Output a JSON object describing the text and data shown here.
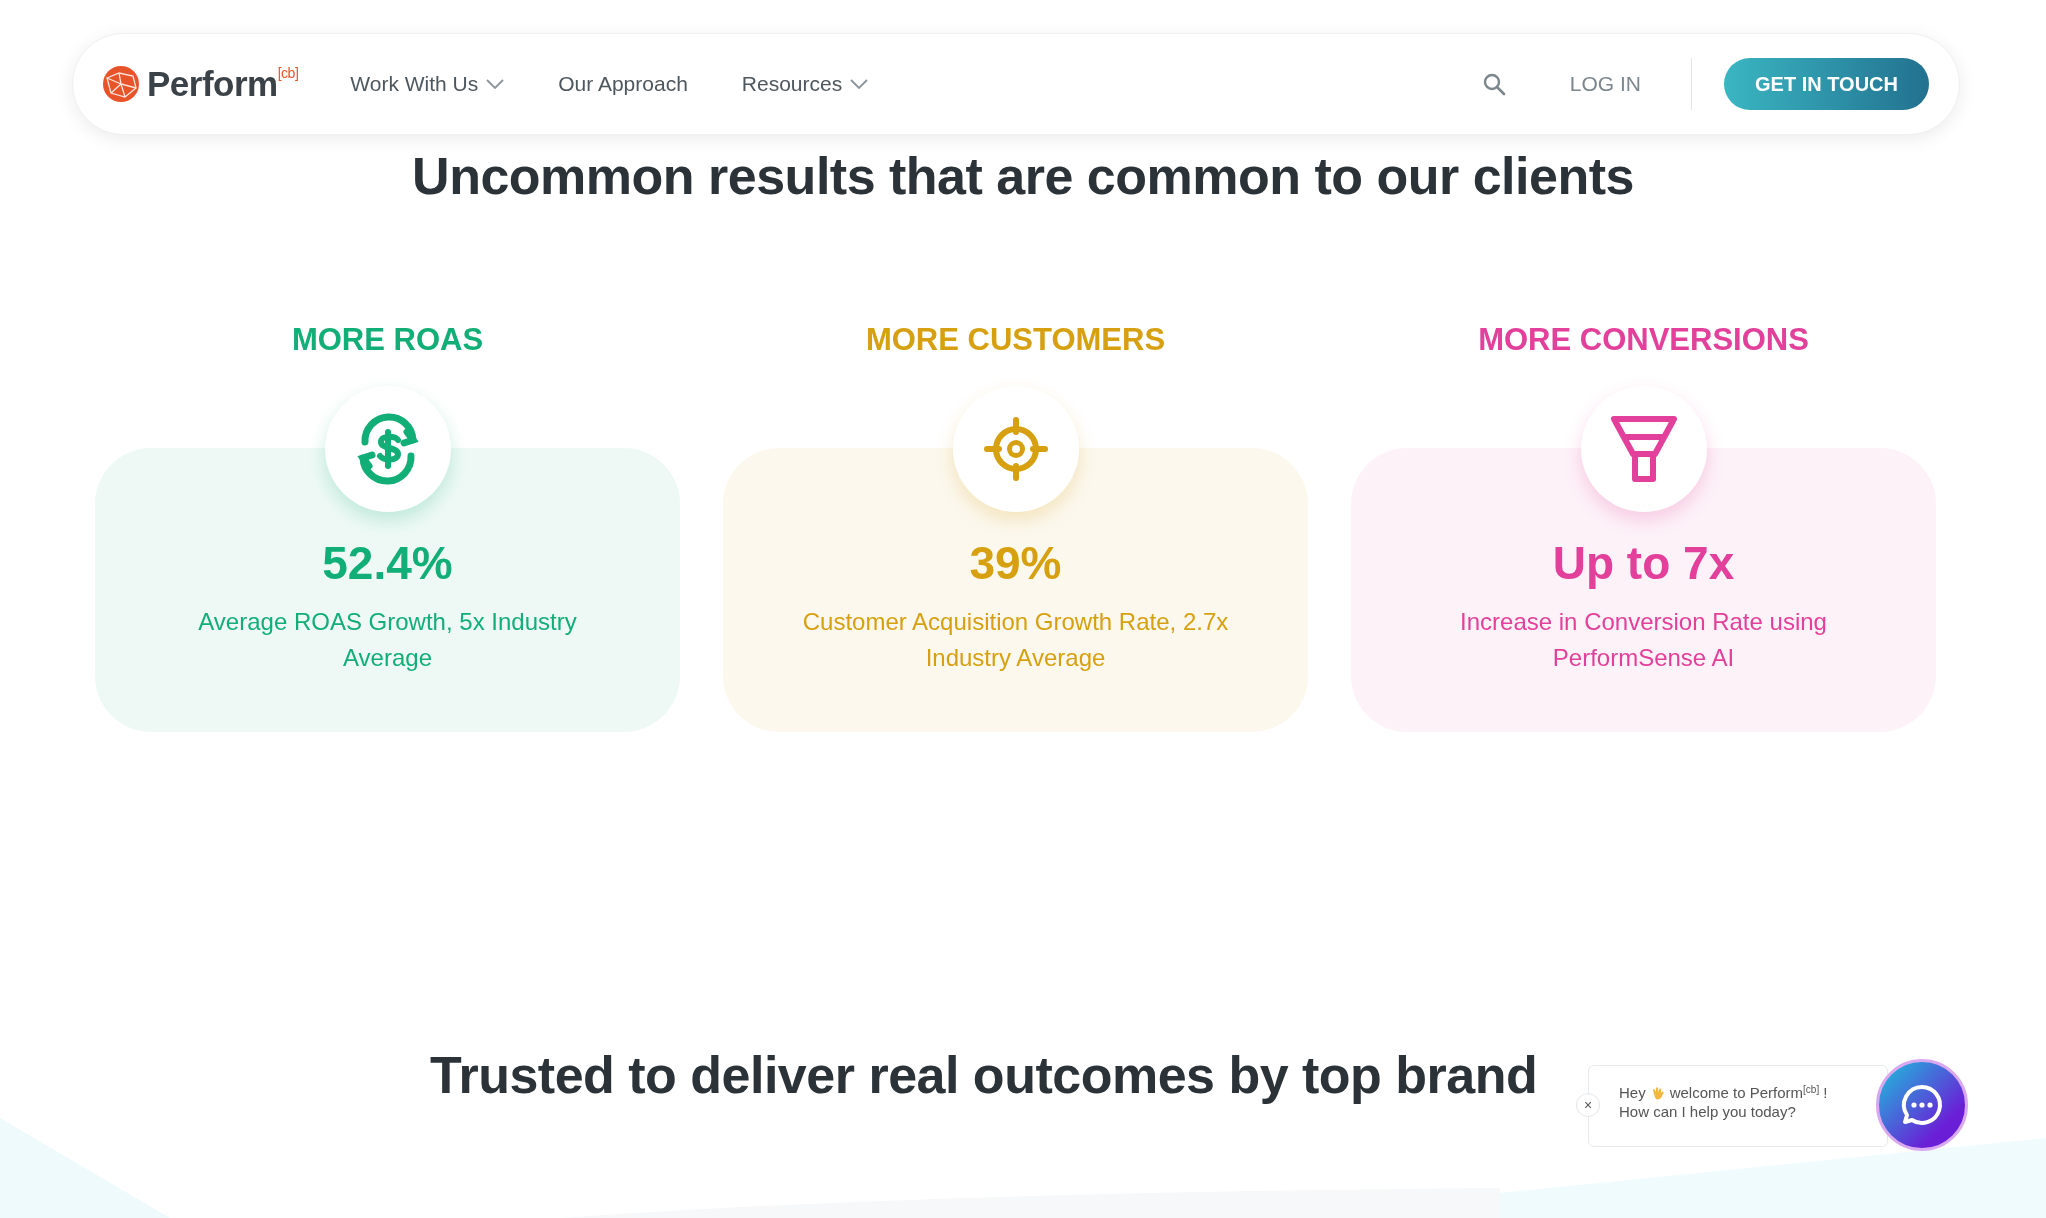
{
  "navbar": {
    "logo": "Perform$^{[cb]}$",
    "items": [
      {
        "label": "Work With Us",
        "dropdown": true
      },
      {
        "label": "Our Approach",
        "dropdown": false
      },
      {
        "label": "Resources",
        "dropdown": true
      }
    ],
    "login": "LOG IN",
    "cta": "GET IN TOUCH"
  },
  "results": {
    "heading": "Uncommon results that are common to our clients",
    "cards": [
      {
        "title": "MORE ROAS",
        "kind": "dollar-cycle",
        "color": "#12ae78",
        "value": "52.4%",
        "description": "Average ROAS Growth, 5x Industry Average"
      },
      {
        "title": "MORE CUSTOMERS",
        "kind": "target",
        "color": "#d6a010",
        "value": "39%",
        "description": "Customer Acquisition Growth Rate, 2.7x Industry Average"
      },
      {
        "title": "MORE CONVERSIONS",
        "kind": "funnel",
        "color": "#e2409a",
        "value": "Up to 7x",
        "description": "Increase in Conversion Rate using PerformSense AI"
      }
    ]
  },
  "brands": {
    "heading": "Trusted to deliver real outcomes by top brand"
  },
  "chat": {
    "greeting_start": "Hey",
    "greeting_end": "welcome to Perform$^{[cb]}$ !",
    "question": "How can I help you today?",
    "close": "×"
  }
}
